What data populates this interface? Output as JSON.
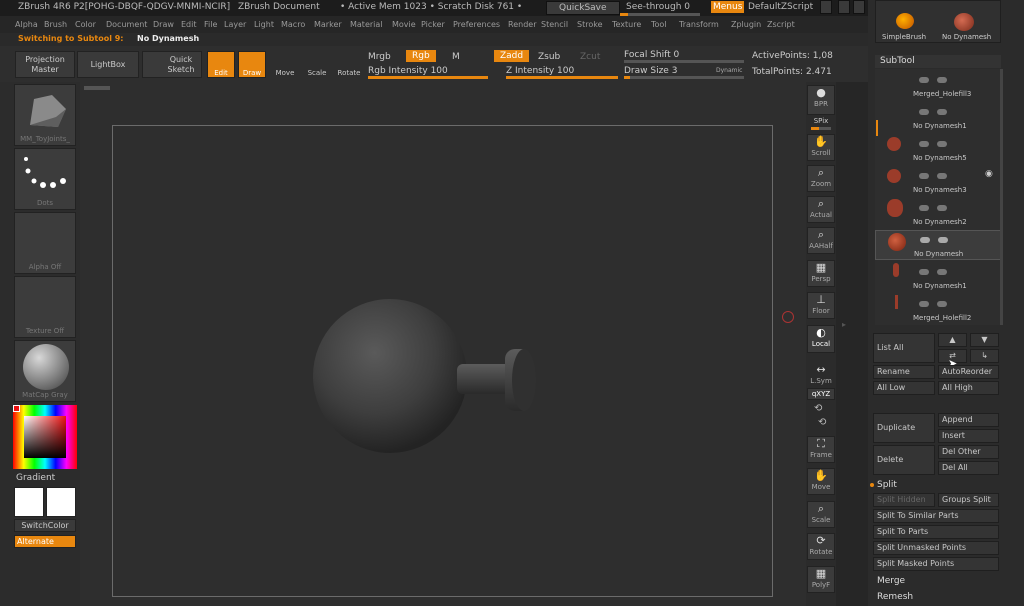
{
  "titlebar": {
    "app": "ZBrush 4R6 P2[POHG-DBQF-QDGV-MNMI-NCIR]",
    "doc": "ZBrush Document",
    "mem": "• Active Mem 1023 • Scratch Disk 761 •",
    "quicksave": "QuickSave",
    "seethrough": "See-through  0",
    "menus": "Menus",
    "script": "DefaultZScript"
  },
  "menus": [
    "Alpha",
    "Brush",
    "Color",
    "Document",
    "Draw",
    "Edit",
    "File",
    "Layer",
    "Light",
    "Macro",
    "Marker",
    "Material",
    "Movie",
    "Picker",
    "Preferences",
    "Render",
    "Stencil",
    "Stroke",
    "Texture",
    "Tool",
    "Transform",
    "Zplugin",
    "Zscript"
  ],
  "status": {
    "switching": "Switching to Subtool 9:",
    "name": "No Dynamesh"
  },
  "topshelf": {
    "projection": "Projection Master",
    "lightbox": "LightBox",
    "quicksketch": "Quick Sketch",
    "edit": "Edit",
    "draw": "Draw",
    "move": "Move",
    "scale": "Scale",
    "rotate": "Rotate",
    "mrgb": "Mrgb",
    "rgb": "Rgb",
    "m": "M",
    "zadd": "Zadd",
    "zsub": "Zsub",
    "zcut": "Zcut",
    "rgb_intensity": "Rgb Intensity 100",
    "z_intensity": "Z Intensity 100",
    "focal_shift": "Focal Shift 0",
    "draw_size": "Draw Size 3",
    "dynamic": "Dynamic",
    "active_points": "ActivePoints: 1,08",
    "total_points": "TotalPoints: 2.471"
  },
  "leftshelf": {
    "brush": "MM_ToyJoints_",
    "stroke": "Dots",
    "alpha": "Alpha Off",
    "texture": "Texture Off",
    "material": "MatCap Gray",
    "gradient": "Gradient",
    "switchcolor": "SwitchColor",
    "alternate": "Alternate"
  },
  "rightshelf": [
    {
      "icon": "bpr",
      "label": "BPR"
    },
    {
      "icon": "spix",
      "label": "SPix"
    },
    {
      "icon": "scroll",
      "label": "Scroll"
    },
    {
      "icon": "zoom",
      "label": "Zoom"
    },
    {
      "icon": "actual",
      "label": "Actual"
    },
    {
      "icon": "aahalf",
      "label": "AAHalf"
    },
    {
      "icon": "persp",
      "label": "Persp"
    },
    {
      "icon": "floor",
      "label": "Floor"
    },
    {
      "icon": "local",
      "label": "Local"
    },
    {
      "icon": "lsym",
      "label": "L.Sym"
    },
    {
      "icon": "xyz",
      "label": "qXYZ"
    },
    {
      "icon": "frame",
      "label": "Frame"
    },
    {
      "icon": "move",
      "label": "Move"
    },
    {
      "icon": "scale",
      "label": "Scale"
    },
    {
      "icon": "rotate",
      "label": "Rotate"
    },
    {
      "icon": "polyf",
      "label": "PolyF"
    }
  ],
  "panel": {
    "simplebrush": "SimpleBrush",
    "nodynamesh": "No Dynamesh",
    "subtool_header": "SubTool",
    "subtools": [
      "Merged_Holefill3",
      "No Dynamesh1",
      "No Dynamesh5",
      "No Dynamesh3",
      "No Dynamesh2",
      "No Dynamesh",
      "No Dynamesh1",
      "Merged_Holefill2"
    ],
    "list_all": "List All",
    "rename": "Rename",
    "autoreorder": "AutoReorder",
    "all_low": "All Low",
    "all_high": "All High",
    "duplicate": "Duplicate",
    "append": "Append",
    "insert": "Insert",
    "delete": "Delete",
    "del_other": "Del Other",
    "del_all": "Del All",
    "split": "Split",
    "split_hidden": "Split Hidden",
    "groups_split": "Groups Split",
    "split_similar": "Split To Similar Parts",
    "split_parts": "Split To Parts",
    "split_unmasked": "Split Unmasked Points",
    "split_masked": "Split Masked Points",
    "merge": "Merge",
    "remesh": "Remesh"
  }
}
